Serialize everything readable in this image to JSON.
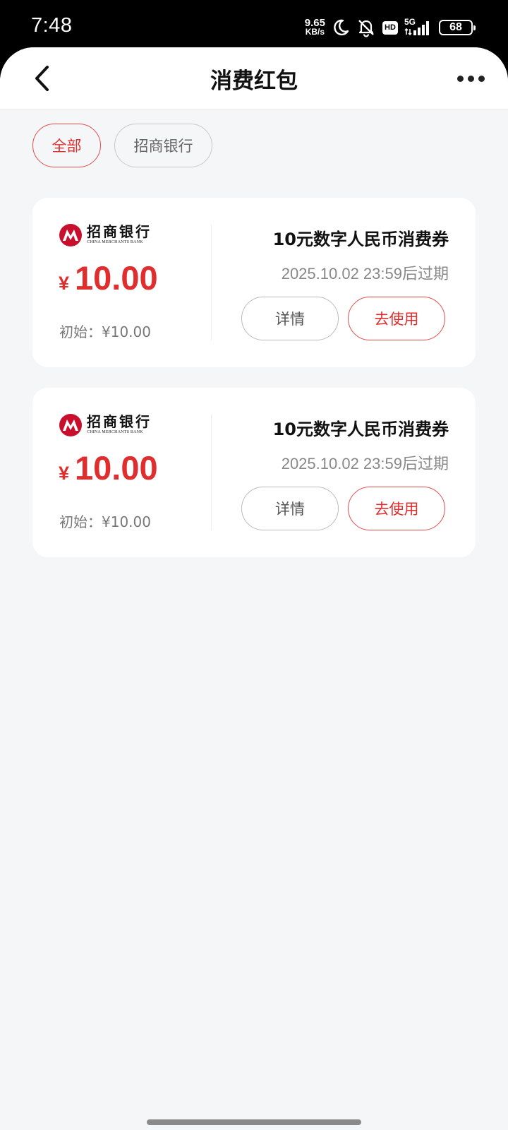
{
  "status_bar": {
    "time": "7:48",
    "net_speed_value": "9.65",
    "net_speed_unit": "KB/s",
    "hd_label": "HD",
    "network_type": "5G",
    "battery": "68"
  },
  "nav": {
    "title": "消费红包"
  },
  "filters": [
    {
      "label": "全部",
      "active": true
    },
    {
      "label": "招商银行",
      "active": false
    }
  ],
  "coupons": [
    {
      "bank_name": "招商银行",
      "bank_name_en": "CHINA MERCHANTS BANK",
      "currency": "¥",
      "amount": "10.00",
      "initial": "初始：¥10.00",
      "title": "10元数字人民币消费券",
      "expiry_date": "2025.10.02 23:59",
      "expiry_suffix": "后过期",
      "detail_label": "详情",
      "use_label": "去使用"
    },
    {
      "bank_name": "招商银行",
      "bank_name_en": "CHINA MERCHANTS BANK",
      "currency": "¥",
      "amount": "10.00",
      "initial": "初始：¥10.00",
      "title": "10元数字人民币消费券",
      "expiry_date": "2025.10.02 23:59",
      "expiry_suffix": "后过期",
      "detail_label": "详情",
      "use_label": "去使用"
    }
  ],
  "colors": {
    "accent": "#e02e2e",
    "background": "#f5f6f8",
    "bank_logo_red": "#c8102e"
  }
}
